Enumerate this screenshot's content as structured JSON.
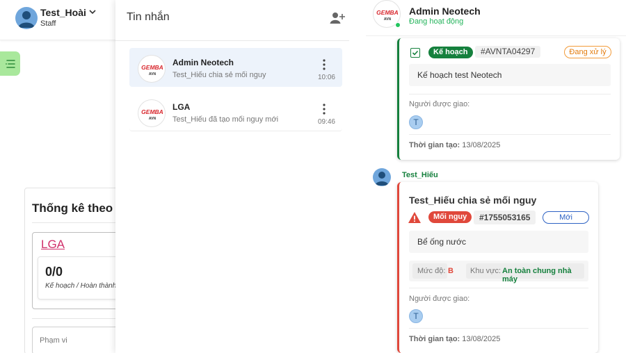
{
  "user": {
    "name": "Test_Hoài",
    "role": "Staff"
  },
  "stats": {
    "title": "Thống kê theo đ",
    "org_link": "LGA",
    "count": "0/0",
    "count_label": "Kế hoạch / Hoàn thành",
    "scope_placeholder": "Phạm vi"
  },
  "messages": {
    "title": "Tin nhắn",
    "conversations": [
      {
        "name": "Admin Neotech",
        "preview": "Test_Hiếu chia sẻ mối nguy",
        "time": "10:06"
      },
      {
        "name": "LGA",
        "preview": "Test_Hiếu đã tạo mối nguy mới",
        "time": "09:46"
      }
    ]
  },
  "logo": {
    "line1": "GEMBA",
    "line2": "AVN"
  },
  "chat": {
    "name": "Admin Neotech",
    "status": "Đang hoạt động",
    "plan_card": {
      "badge": "Kế hoạch",
      "code": "#AVNTA04297",
      "status": "Đang xử lý",
      "content": "Kế hoạch test Neotech",
      "assignee_label": "Người được giao:",
      "assignee_initial": "T",
      "time_label": "Thời gian tạo:",
      "time_value": "13/08/2025"
    },
    "sender": "Test_Hiếu",
    "hazard_card": {
      "title": "Test_Hiếu chia sẻ mối nguy",
      "badge": "Mối nguy",
      "code": "#1755053165",
      "status": "Mới",
      "content": "Bể ống nước",
      "severity_label": "Mức độ:",
      "severity_value": "B",
      "area_label": "Khu vực:",
      "area_value": "An toàn chung nhà máy",
      "assignee_label": "Người được giao:",
      "assignee_initial": "T",
      "time_label": "Thời gian tạo:",
      "time_value": "13/08/2025"
    }
  },
  "colors": {
    "accent_green": "#15803d",
    "hazard_red": "#e0483b",
    "processing_orange": "#e37b0c",
    "new_blue": "#2d62c4",
    "online_green": "#22c55e",
    "link_pink": "#d0306a"
  }
}
